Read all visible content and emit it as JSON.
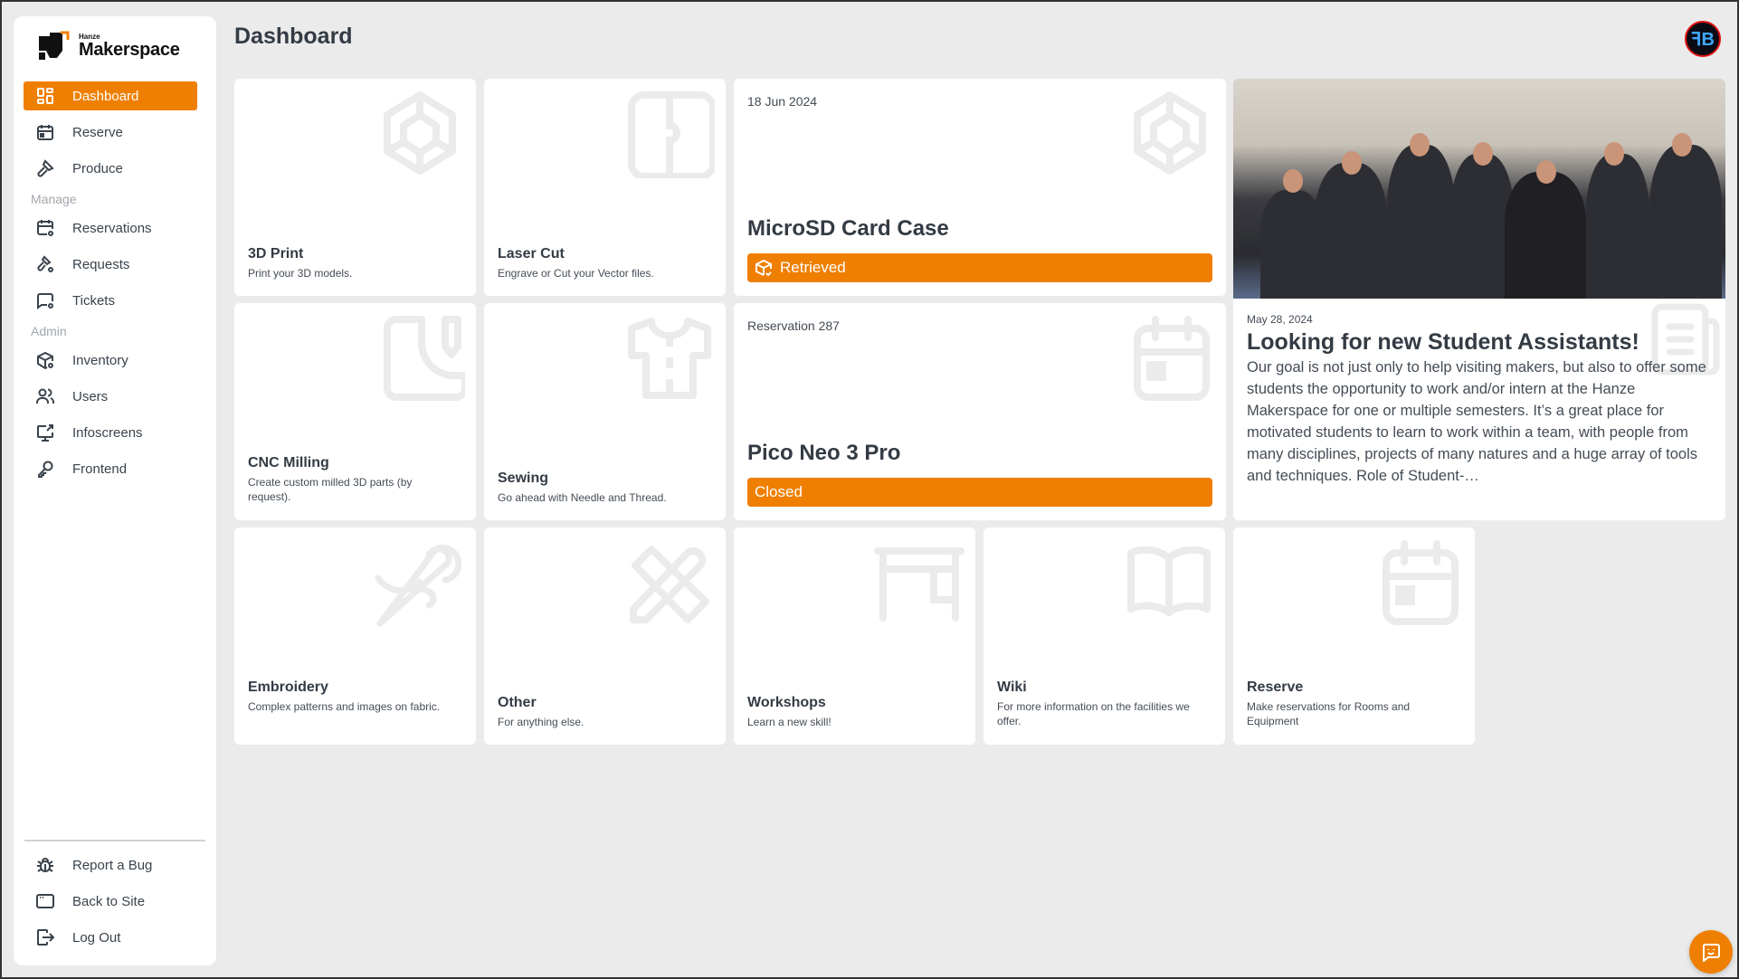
{
  "brand": {
    "small": "Hanze",
    "big": "Makerspace",
    "accent": "#ef7f00"
  },
  "page": {
    "title": "Dashboard"
  },
  "user": {
    "avatar_initials": "ꟻB"
  },
  "sidebar": {
    "main": [
      {
        "label": "Dashboard",
        "icon": "dashboard-icon",
        "active": true
      },
      {
        "label": "Reserve",
        "icon": "calendar-icon"
      },
      {
        "label": "Produce",
        "icon": "hammer-icon"
      }
    ],
    "manage_heading": "Manage",
    "manage": [
      {
        "label": "Reservations",
        "icon": "calendar-gear-icon"
      },
      {
        "label": "Requests",
        "icon": "hammer-gear-icon"
      },
      {
        "label": "Tickets",
        "icon": "message-gear-icon"
      }
    ],
    "admin_heading": "Admin",
    "admin": [
      {
        "label": "Inventory",
        "icon": "box-gear-icon"
      },
      {
        "label": "Users",
        "icon": "users-icon"
      },
      {
        "label": "Infoscreens",
        "icon": "screen-share-icon"
      },
      {
        "label": "Frontend",
        "icon": "key-icon"
      }
    ],
    "footer": [
      {
        "label": "Report a Bug",
        "icon": "bug-icon"
      },
      {
        "label": "Back to Site",
        "icon": "browser-icon"
      },
      {
        "label": "Log Out",
        "icon": "logout-icon"
      }
    ]
  },
  "tiles": [
    {
      "title": "3D Print",
      "desc": "Print your 3D models.",
      "icon": "cube-icon"
    },
    {
      "title": "Laser Cut",
      "desc": "Engrave or Cut your Vector files.",
      "icon": "laser-cut-icon"
    },
    {
      "title": "CNC Milling",
      "desc": "Create custom milled 3D parts (by request).",
      "icon": "cnc-icon"
    },
    {
      "title": "Sewing",
      "desc": "Go ahead with Needle and Thread.",
      "icon": "shirt-icon"
    },
    {
      "title": "Embroidery",
      "desc": "Complex patterns and images on fabric.",
      "icon": "needle-icon"
    },
    {
      "title": "Other",
      "desc": "For anything else.",
      "icon": "tools-icon"
    },
    {
      "title": "Workshops",
      "desc": "Learn a new skill!",
      "icon": "desk-icon"
    },
    {
      "title": "Wiki",
      "desc": "For more information on the facilities we offer.",
      "icon": "book-icon"
    },
    {
      "title": "Reserve",
      "desc": "Make reservations for Rooms and Equipment",
      "icon": "calendar-icon"
    }
  ],
  "status_cards": [
    {
      "meta": "18 Jun 2024",
      "name": "MicroSD Card Case",
      "status": "Retrieved",
      "icon": "cube-icon",
      "status_icon": "box-check-icon"
    },
    {
      "meta": "Reservation 287",
      "name": "Pico Neo 3 Pro",
      "status": "Closed",
      "icon": "calendar-icon"
    }
  ],
  "news": {
    "date": "May 28, 2024",
    "headline": "Looking for new Student Assistants!",
    "body": "Our goal is not just only to help visiting makers, but also to offer some students the opportunity to work and/or intern at the Hanze Makerspace for one or multiple semesters. It’s a great place for motivated students to learn to work within a team, with people from many disciplines, projects of many natures and a huge array of tools and techniques. Role of Student-…",
    "photo_alt": "Group photo of Makerspace team"
  }
}
